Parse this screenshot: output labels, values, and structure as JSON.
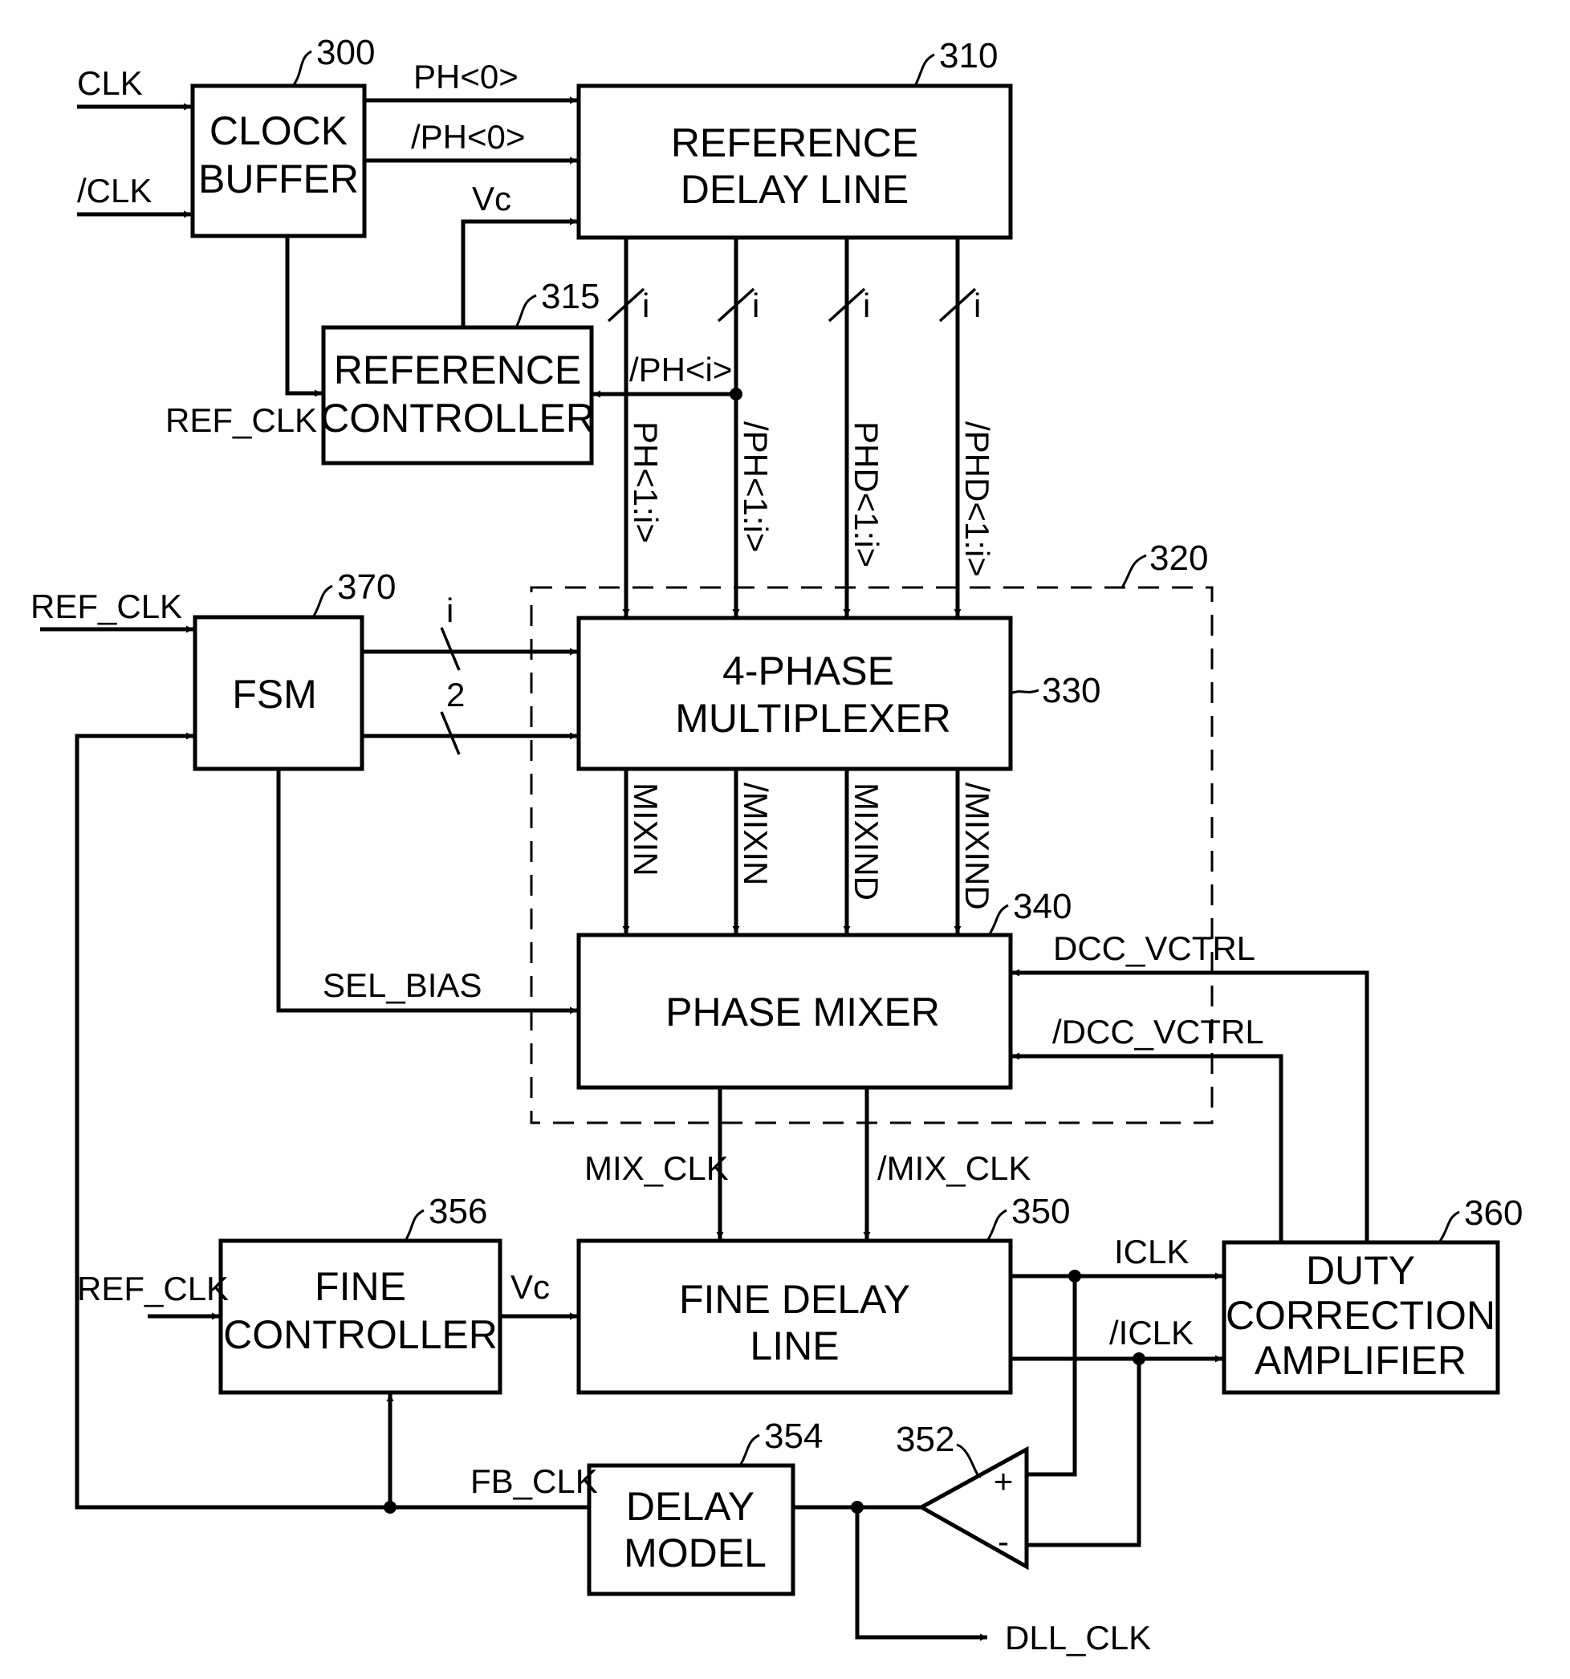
{
  "figure": {
    "blocks": {
      "clock_buffer": {
        "lines": [
          "CLOCK",
          "BUFFER"
        ],
        "ref": "300"
      },
      "reference_delay_line": {
        "lines": [
          "REFERENCE",
          "DELAY LINE"
        ],
        "ref": "310"
      },
      "reference_controller": {
        "lines": [
          "REFERENCE",
          "CONTROLLER"
        ],
        "ref": "315"
      },
      "phase_mixing_unit": {
        "ref": "320"
      },
      "four_phase_multiplexer": {
        "lines": [
          "4-PHASE",
          "MULTIPLEXER"
        ],
        "ref": "330"
      },
      "phase_mixer": {
        "lines": [
          "PHASE MIXER"
        ],
        "ref": "340"
      },
      "fine_delay_line": {
        "lines": [
          "FINE DELAY",
          "LINE"
        ],
        "ref": "350"
      },
      "comparator": {
        "ref": "352",
        "plus": "+",
        "minus": "-"
      },
      "delay_model": {
        "lines": [
          "DELAY",
          "MODEL"
        ],
        "ref": "354"
      },
      "fine_controller": {
        "lines": [
          "FINE",
          "CONTROLLER"
        ],
        "ref": "356"
      },
      "duty_correction_amplifier": {
        "lines": [
          "DUTY",
          "CORRECTION",
          "AMPLIFIER"
        ],
        "ref": "360"
      },
      "fsm": {
        "lines": [
          "FSM"
        ],
        "ref": "370"
      }
    },
    "signals": {
      "clk": "CLK",
      "clk_b": "/CLK",
      "ph0": "PH<0>",
      "ph0_b": "/PH<0>",
      "vc_ref": "Vc",
      "ref_clk_ctrl": "REF_CLK",
      "ph_i_b": "/PH<i>",
      "bus_width_i": "i",
      "ph_bus": "PH<1:i>",
      "ph_bus_b": "/PH<1:i>",
      "phd_bus": "PHD<1:i>",
      "phd_bus_b": "/PHD<1:i>",
      "ref_clk_fsm": "REF_CLK",
      "fsm_bus_i": "i",
      "fsm_bus_2": "2",
      "mixin": "MIXIN",
      "mixin_b": "/MIXIN",
      "mixind": "MIXIND",
      "mixind_b": "/MIXIND",
      "sel_bias": "SEL_BIAS",
      "dcc_vctrl": "DCC_VCTRL",
      "dcc_vctrl_b": "/DCC_VCTRL",
      "mix_clk": "MIX_CLK",
      "mix_clk_b": "/MIX_CLK",
      "ref_clk_fine": "REF_CLK",
      "vc_fine": "Vc",
      "iclk": "ICLK",
      "iclk_b": "/ICLK",
      "fb_clk": "FB_CLK",
      "dll_clk": "DLL_CLK"
    }
  }
}
